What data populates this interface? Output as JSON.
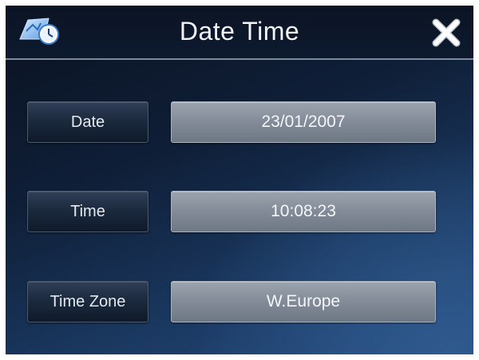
{
  "window": {
    "title": "Date Time",
    "app_icon": "world-clock-icon",
    "close_icon": "close-icon"
  },
  "fields": {
    "date": {
      "label": "Date",
      "value": "23/01/2007"
    },
    "time": {
      "label": "Time",
      "value": "10:08:23"
    },
    "time_zone": {
      "label": "Time Zone",
      "value": "W.Europe"
    }
  },
  "colors": {
    "background_dark": "#0a1220",
    "background_blue": "#24497a",
    "label_button": "#1c2a3e",
    "value_field": "#848d99",
    "text": "#f2f4f7"
  }
}
